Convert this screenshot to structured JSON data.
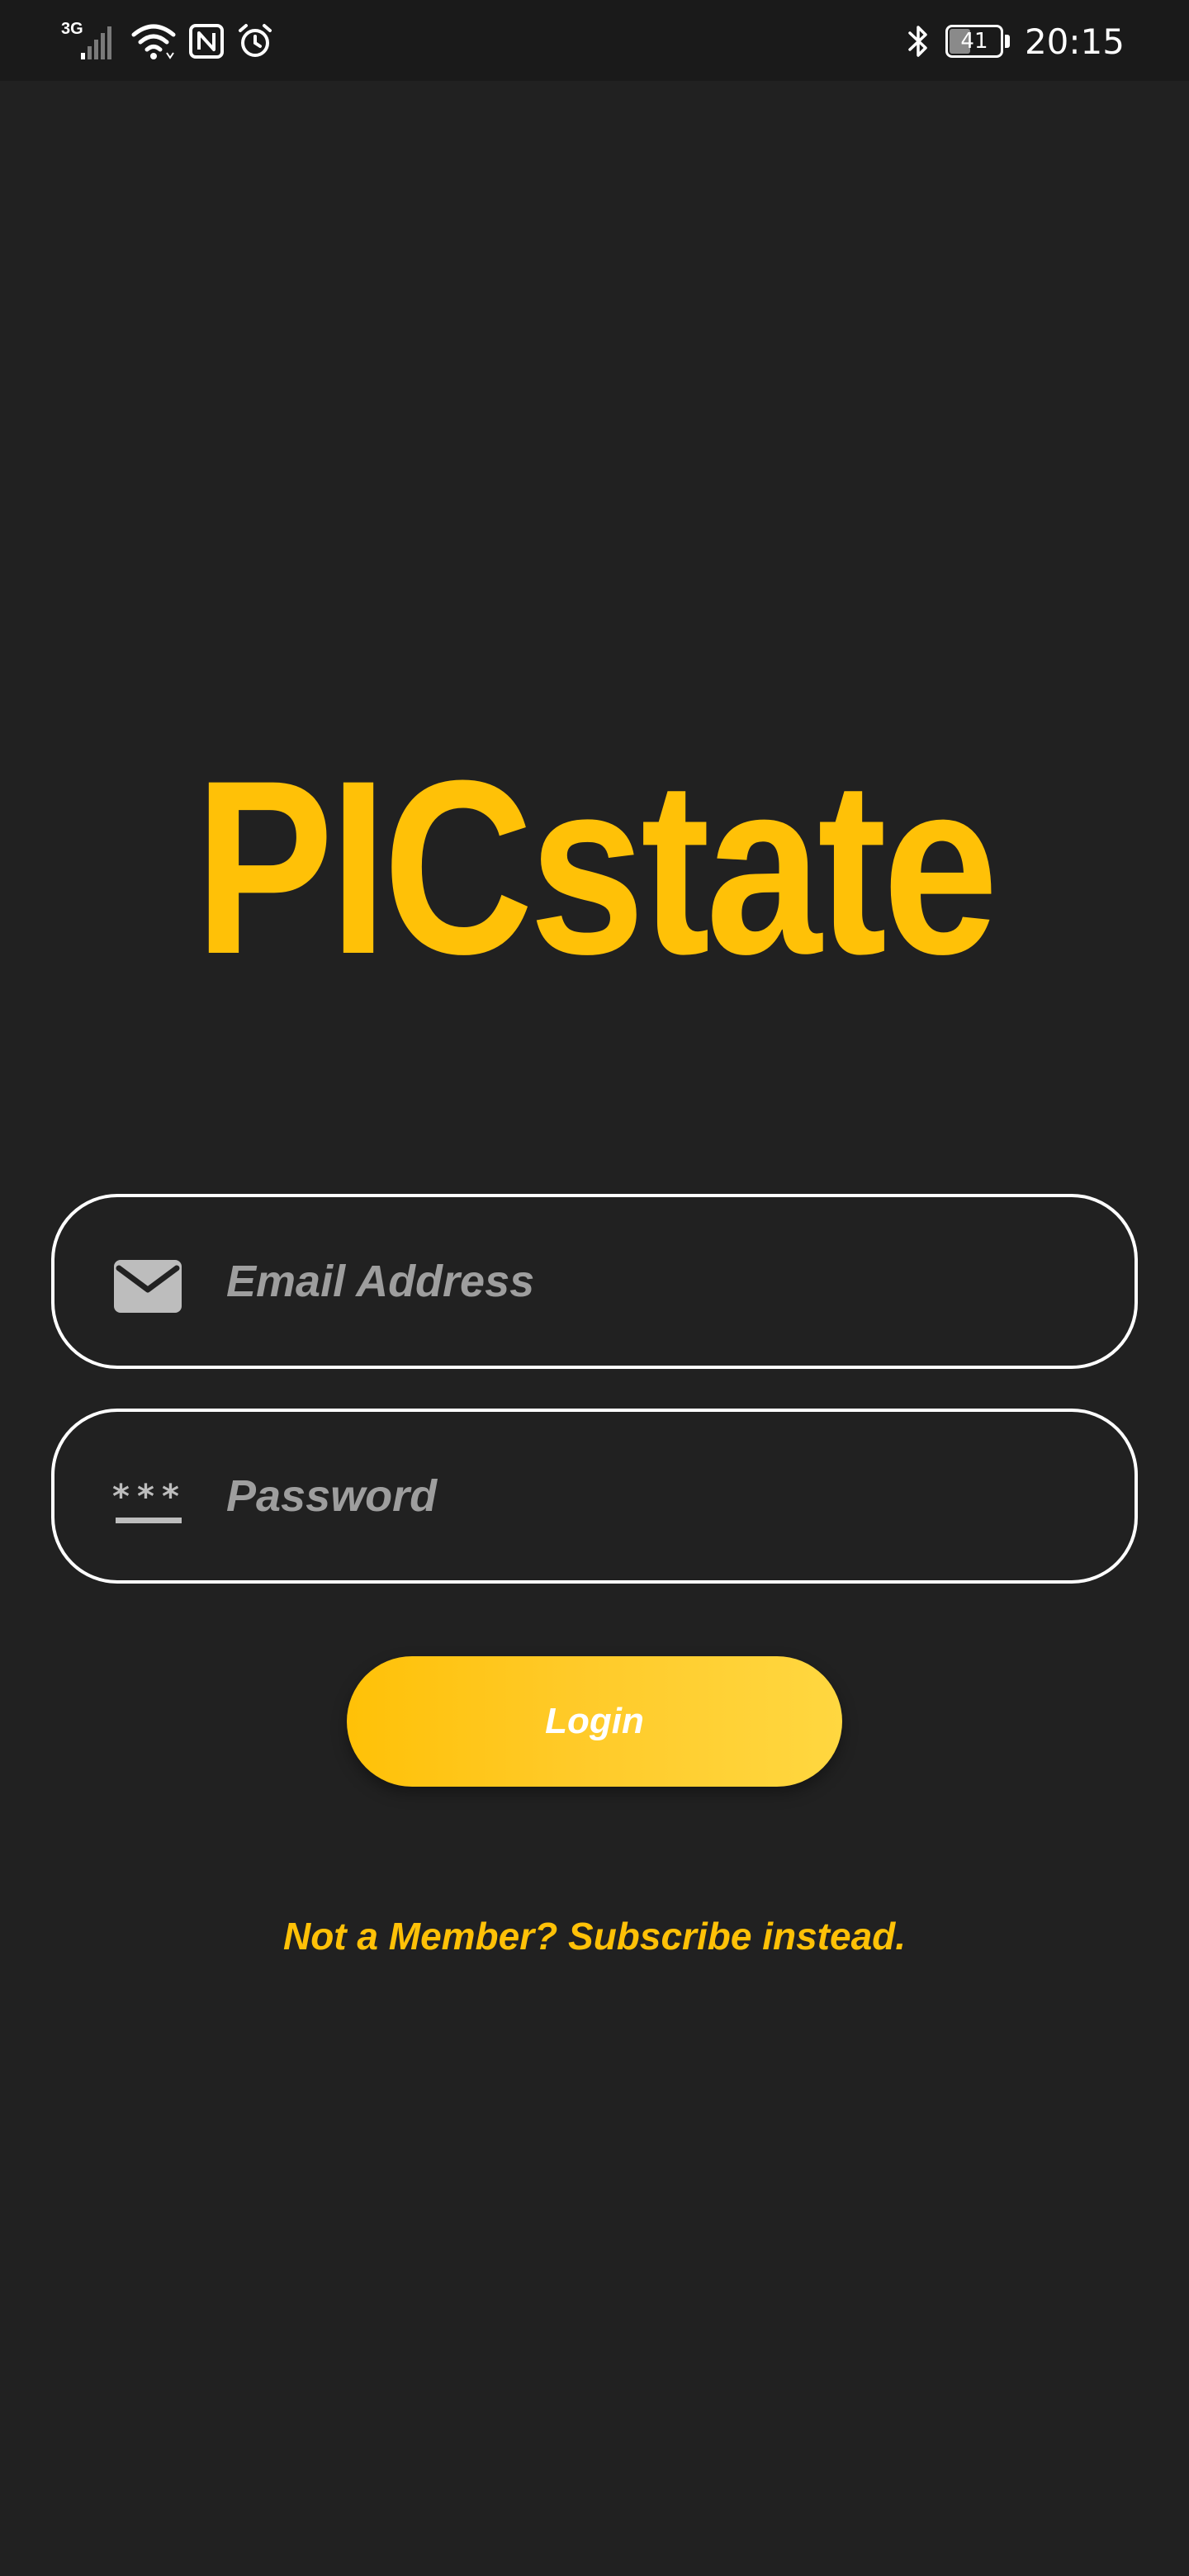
{
  "status_bar": {
    "network_type": "3G",
    "battery_level": "41",
    "battery_fraction": 0.41,
    "time": "20:15",
    "icons": [
      "signal-icon",
      "wifi-icon",
      "nfc-icon",
      "alarm-icon",
      "bluetooth-icon",
      "battery-icon"
    ]
  },
  "app": {
    "logo_text": "PICstate",
    "brand_color": "#FFC107",
    "background_color": "#212121"
  },
  "form": {
    "email": {
      "placeholder": "Email Address",
      "value": "",
      "icon": "mail-icon"
    },
    "password": {
      "placeholder": "Password",
      "value": "",
      "icon": "password-icon"
    },
    "login_label": "Login",
    "subscribe_label": "Not a Member? Subscribe instead."
  }
}
